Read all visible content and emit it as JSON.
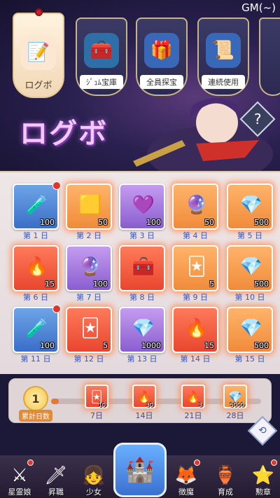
{
  "header": {
    "gm_label": "GM(~)"
  },
  "tabs": [
    {
      "label": "ログボ",
      "icon": "📝",
      "active": true
    },
    {
      "label": "ｼﾞｭﾑ宝庫",
      "icon": "🧰",
      "active": false
    },
    {
      "label": "全員探宝",
      "icon": "🎁",
      "active": false
    },
    {
      "label": "連続使用",
      "icon": "📜",
      "active": false
    }
  ],
  "banner": {
    "title": "ログボ",
    "help_label": "?"
  },
  "rewards": [
    {
      "day": "第 1 日",
      "qty": "100",
      "icon": "🧪",
      "bg": "blue"
    },
    {
      "day": "第 2 日",
      "qty": "50",
      "icon": "🟨",
      "bg": "orange"
    },
    {
      "day": "第 3 日",
      "qty": "100",
      "icon": "💜",
      "bg": "purple"
    },
    {
      "day": "第 4 日",
      "qty": "50",
      "icon": "🔮",
      "bg": "orange"
    },
    {
      "day": "第 5 日",
      "qty": "500",
      "icon": "💎",
      "bg": "orange"
    },
    {
      "day": "第 6 日",
      "qty": "15",
      "icon": "🔥",
      "bg": "red"
    },
    {
      "day": "第 7 日",
      "qty": "100",
      "icon": "🔮",
      "bg": "purple"
    },
    {
      "day": "第 8 日",
      "qty": "",
      "icon": "🧰",
      "bg": "red"
    },
    {
      "day": "第 9 日",
      "qty": "5",
      "icon": "🃏",
      "bg": "orange"
    },
    {
      "day": "第 10 日",
      "qty": "500",
      "icon": "💎",
      "bg": "orange"
    },
    {
      "day": "第 11 日",
      "qty": "100",
      "icon": "🧪",
      "bg": "blue"
    },
    {
      "day": "第 12 日",
      "qty": "5",
      "icon": "🃏",
      "bg": "red"
    },
    {
      "day": "第 13 日",
      "qty": "1000",
      "icon": "💎",
      "bg": "purple"
    },
    {
      "day": "第 14 日",
      "qty": "15",
      "icon": "🔥",
      "bg": "red"
    },
    {
      "day": "第 15 日",
      "qty": "500",
      "icon": "💎",
      "bg": "orange"
    }
  ],
  "progress": {
    "current": "1",
    "label": "累計日数",
    "milestones": [
      {
        "day": "7日",
        "qty": "10",
        "icon": "🃏"
      },
      {
        "day": "14日",
        "qty": "30",
        "icon": "🔥"
      },
      {
        "day": "21日",
        "qty": "3",
        "icon": "🔥"
      },
      {
        "day": "28日",
        "qty": "5000",
        "icon": "💎"
      }
    ]
  },
  "nav": [
    {
      "label": "星霊娘",
      "icon": "⚔"
    },
    {
      "label": "昇職",
      "icon": "🗡"
    },
    {
      "label": "少女",
      "icon": "👧"
    },
    {
      "label": "",
      "icon": "🏰"
    },
    {
      "label": "徴魔",
      "icon": "🦊"
    },
    {
      "label": "育成",
      "icon": "🏺"
    },
    {
      "label": "勲章",
      "icon": "⭐"
    }
  ]
}
